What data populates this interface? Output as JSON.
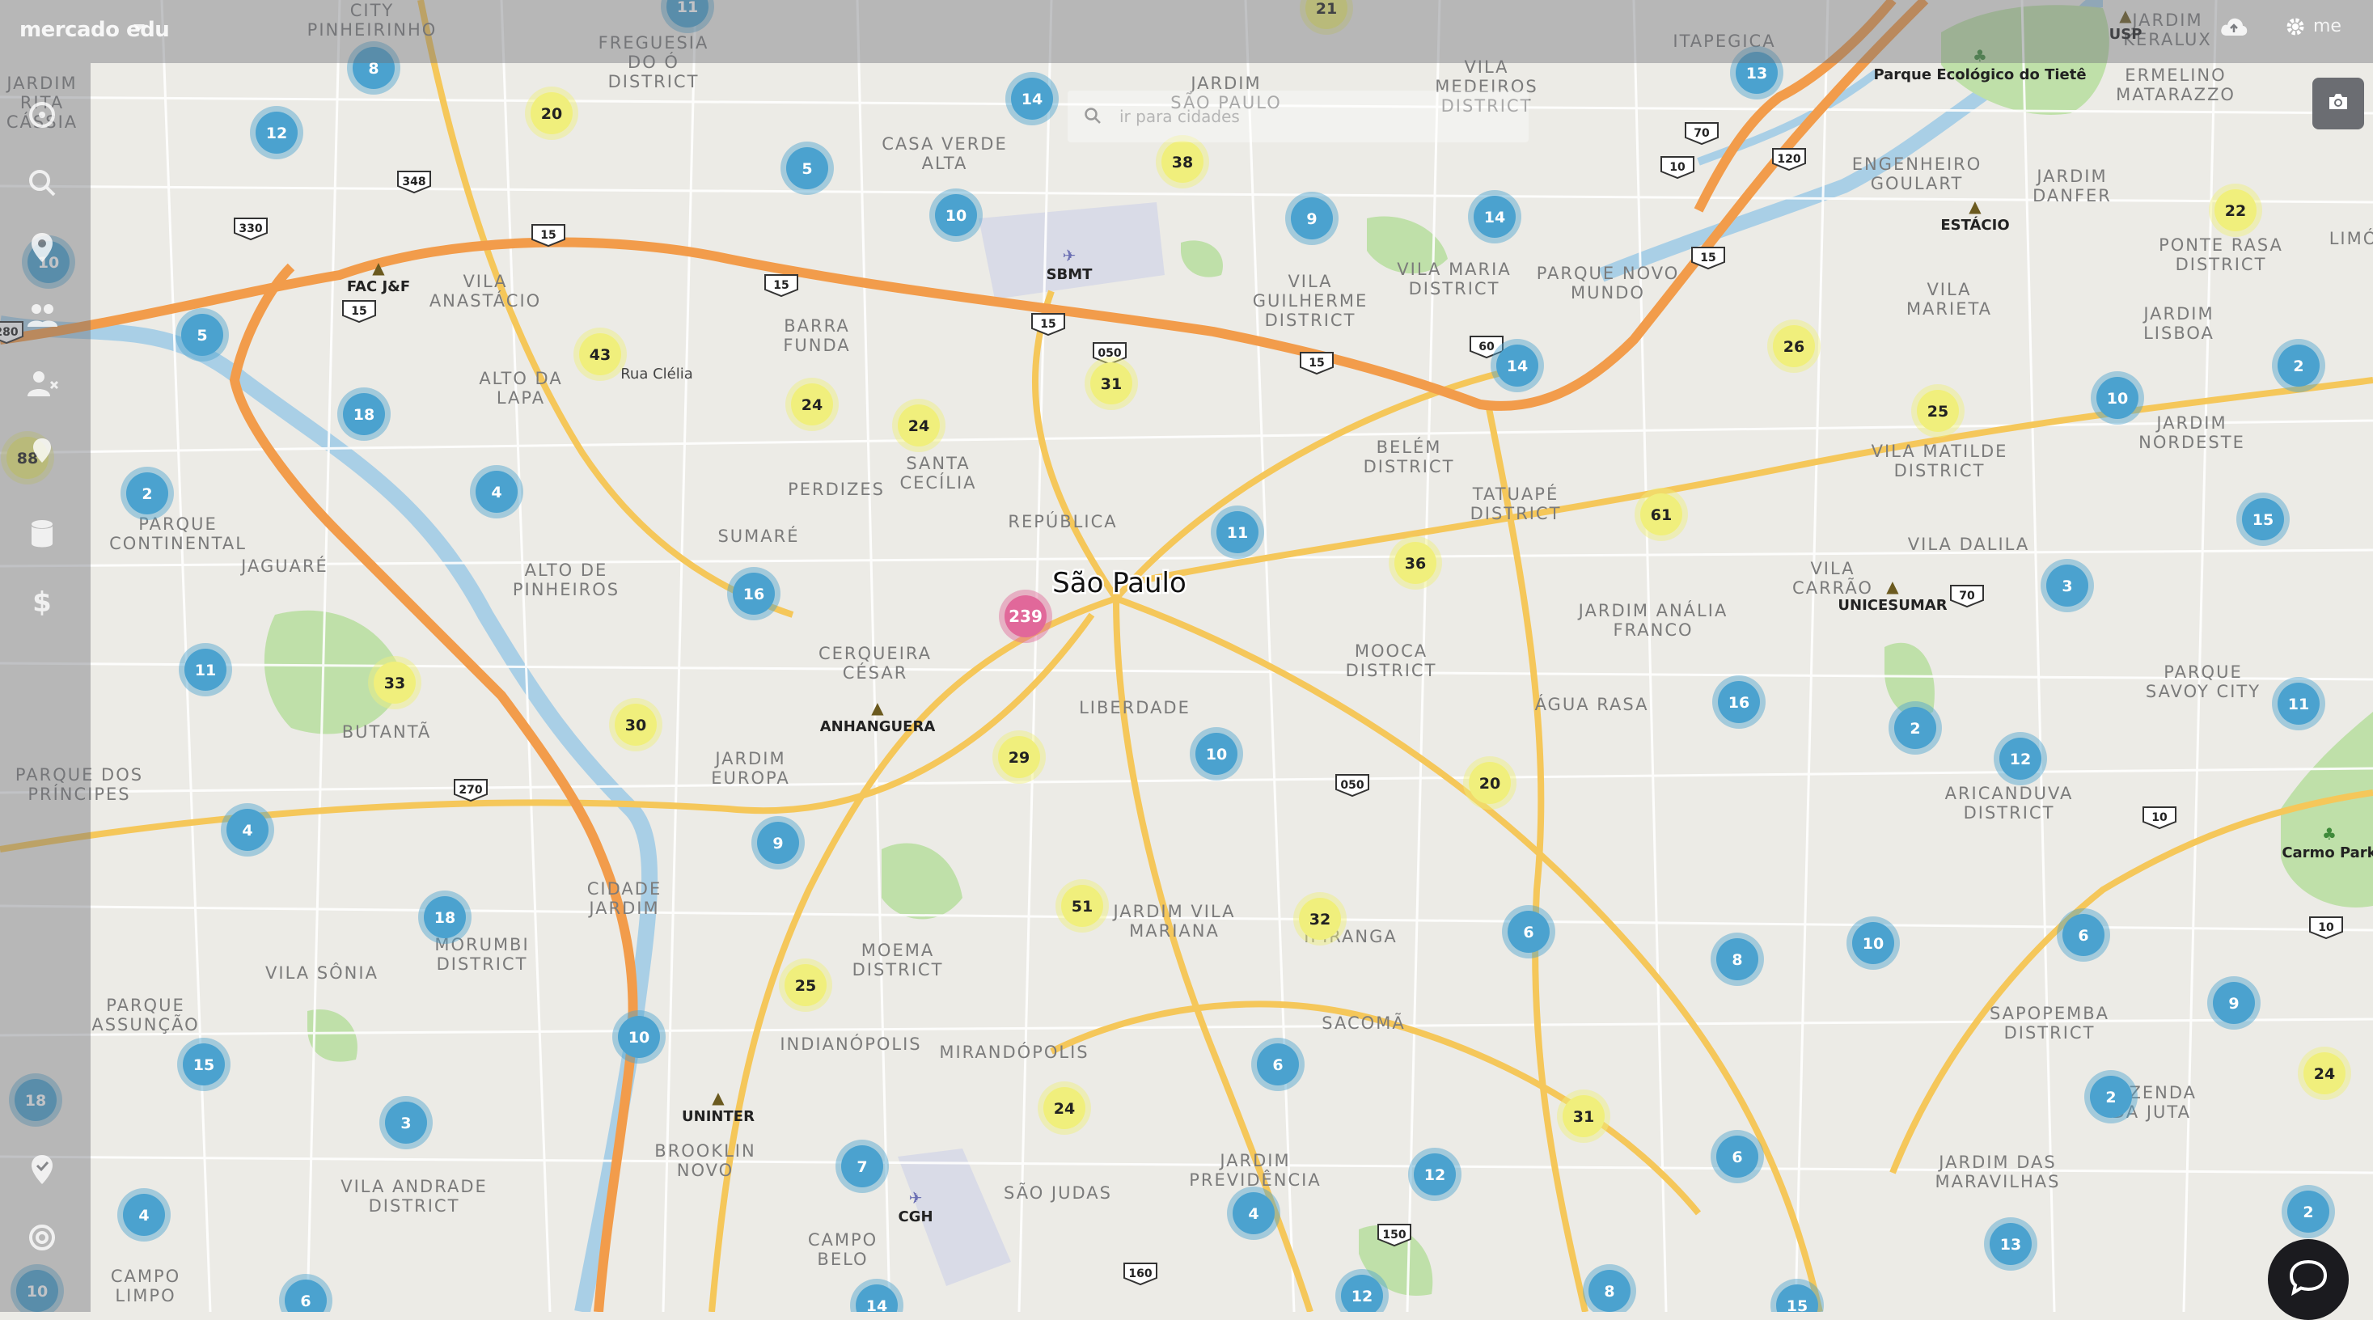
{
  "app": {
    "logo_text": "mercado edu",
    "user_label": "me"
  },
  "search": {
    "placeholder": "ir para cidades"
  },
  "map": {
    "city_label": "São Paulo",
    "colors": {
      "land": "#ecebe6",
      "major_road": "#f5b742",
      "highway": "#f29c4b",
      "street": "#ffffff",
      "park": "#bfe0a9",
      "water": "#a9cfe6",
      "cluster_small": "#4ba2cf",
      "cluster_medium": "#f0ef7c",
      "cluster_large": "#e1689a"
    },
    "districts": [
      {
        "lines": [
          "CITY",
          "PINHEIRINHO"
        ]
      },
      {
        "lines": [
          "FREGUESIA",
          "DO Ó",
          "DISTRICT"
        ]
      },
      {
        "lines": [
          "JARDIM",
          "SÃO PAULO"
        ]
      },
      {
        "lines": [
          "VILA",
          "MEDEIROS",
          "DISTRICT"
        ]
      },
      {
        "lines": [
          "ITAPEGICA"
        ]
      },
      {
        "lines": [
          "JARDIM",
          "KERALUX"
        ]
      },
      {
        "lines": [
          "ERMELINO",
          "MATARAZZO"
        ]
      },
      {
        "lines": [
          "JARDIM",
          "RITA",
          "CÁSSIA"
        ]
      },
      {
        "lines": [
          "CASA VERDE",
          "ALTA"
        ]
      },
      {
        "lines": [
          "ENGENHEIRO",
          "GOULART"
        ]
      },
      {
        "lines": [
          "JARDIM",
          "DANFER"
        ]
      },
      {
        "lines": [
          "VILA MARIA",
          "DISTRICT"
        ]
      },
      {
        "lines": [
          "PARQUE NOVO",
          "MUNDO"
        ]
      },
      {
        "lines": [
          "PONTE RASA",
          "DISTRICT"
        ]
      },
      {
        "lines": [
          "VILA",
          "ANASTÁCIO"
        ]
      },
      {
        "lines": [
          "VILA",
          "GUILHERME",
          "DISTRICT"
        ]
      },
      {
        "lines": [
          "BARRA",
          "FUNDA"
        ]
      },
      {
        "lines": [
          "VILA",
          "MARIETA"
        ]
      },
      {
        "lines": [
          "JARDIM",
          "LISBOA"
        ]
      },
      {
        "lines": [
          "ALTO DA",
          "LAPA"
        ]
      },
      {
        "lines": [
          "BELÉM",
          "DISTRICT"
        ]
      },
      {
        "lines": [
          "JARDIM",
          "NORDESTE"
        ]
      },
      {
        "lines": [
          "VILA MATILDE",
          "DISTRICT"
        ]
      },
      {
        "lines": [
          "PERDIZES"
        ]
      },
      {
        "lines": [
          "SANTA",
          "CECÍLIA"
        ]
      },
      {
        "lines": [
          "TATUAPÉ",
          "DISTRICT"
        ]
      },
      {
        "lines": [
          "PARQUE",
          "CONTINENTAL"
        ]
      },
      {
        "lines": [
          "SUMARÉ"
        ]
      },
      {
        "lines": [
          "REPÚBLICA"
        ]
      },
      {
        "lines": [
          "JAGUARÉ"
        ]
      },
      {
        "lines": [
          "ALTO DE",
          "PINHEIROS"
        ]
      },
      {
        "lines": [
          "VILA DALILA"
        ]
      },
      {
        "lines": [
          "VILA",
          "CARRÃO"
        ]
      },
      {
        "lines": [
          "MOOCA",
          "DISTRICT"
        ]
      },
      {
        "lines": [
          "JARDIM ANÁLIA",
          "FRANCO"
        ]
      },
      {
        "lines": [
          "CERQUEIRA",
          "CÉSAR"
        ]
      },
      {
        "lines": [
          "PARQUE",
          "SAVOY CITY"
        ]
      },
      {
        "lines": [
          "LIBERDADE"
        ]
      },
      {
        "lines": [
          "ÁGUA RASA"
        ]
      },
      {
        "lines": [
          "BUTANTÃ"
        ]
      },
      {
        "lines": [
          "JARDIM",
          "EUROPA"
        ]
      },
      {
        "lines": [
          "PARQUE DOS",
          "PRÍNCIPES"
        ]
      },
      {
        "lines": [
          "ARICANDUVA",
          "DISTRICT"
        ]
      },
      {
        "lines": [
          "CIDADE",
          "JARDIM"
        ]
      },
      {
        "lines": [
          "JARDIM VILA",
          "MARIANA"
        ]
      },
      {
        "lines": [
          "IPIRANGA"
        ]
      },
      {
        "lines": [
          "MORUMBI",
          "DISTRICT"
        ]
      },
      {
        "lines": [
          "MOEMA",
          "DISTRICT"
        ]
      },
      {
        "lines": [
          "VILA SÔNIA"
        ]
      },
      {
        "lines": [
          "PARQUE",
          "ASSUNÇÃO"
        ]
      },
      {
        "lines": [
          "SAPOPEMBA",
          "DISTRICT"
        ]
      },
      {
        "lines": [
          "INDIANÓPOLIS"
        ]
      },
      {
        "lines": [
          "MIRANDÓPOLIS"
        ]
      },
      {
        "lines": [
          "SACOMÃ"
        ]
      },
      {
        "lines": [
          "FAZENDA",
          "DA JUTA"
        ]
      },
      {
        "lines": [
          "BROOKLIN",
          "NOVO"
        ]
      },
      {
        "lines": [
          "JARDIM",
          "PREVIDÊNCIA"
        ]
      },
      {
        "lines": [
          "JARDIM DAS",
          "MARAVILHAS"
        ]
      },
      {
        "lines": [
          "VILA ANDRADE",
          "DISTRICT"
        ]
      },
      {
        "lines": [
          "SÃO JUDAS"
        ]
      },
      {
        "lines": [
          "CAMPO",
          "BELO"
        ]
      },
      {
        "lines": [
          "CAMPO",
          "LIMPO"
        ]
      },
      {
        "lines": [
          "LIMÓ"
        ]
      }
    ],
    "pois": [
      {
        "label": "SBMT",
        "type": "airport"
      },
      {
        "label": "CGH",
        "type": "airport"
      },
      {
        "label": "FAC J&F",
        "type": "university"
      },
      {
        "label": "ANHANGUERA",
        "type": "university"
      },
      {
        "label": "UNINTER",
        "type": "university"
      },
      {
        "label": "ESTÁCIO",
        "type": "university"
      },
      {
        "label": "UNICESUMAR",
        "type": "university"
      },
      {
        "label": "USP",
        "type": "university"
      },
      {
        "label": "Parque Ecológico do Tietê",
        "type": "park"
      },
      {
        "label": "Carmo Park",
        "type": "park"
      }
    ],
    "street_labels": [
      "Rua Clélia"
    ],
    "route_shields": [
      "348",
      "330",
      "15",
      "15",
      "15",
      "15",
      "15",
      "15",
      "280",
      "050",
      "050",
      "270",
      "60",
      "70",
      "10",
      "120",
      "70",
      "10",
      "10",
      "160",
      "150"
    ],
    "clusters": [
      {
        "count": 8
      },
      {
        "count": 11
      },
      {
        "count": 21
      },
      {
        "count": 13
      },
      {
        "count": 12
      },
      {
        "count": 20
      },
      {
        "count": 5
      },
      {
        "count": 14
      },
      {
        "count": 38
      },
      {
        "count": 10
      },
      {
        "count": 10
      },
      {
        "count": 9
      },
      {
        "count": 14
      },
      {
        "count": 22
      },
      {
        "count": 5
      },
      {
        "count": 43
      },
      {
        "count": 24
      },
      {
        "count": 24
      },
      {
        "count": 31
      },
      {
        "count": 14
      },
      {
        "count": 26
      },
      {
        "count": 25
      },
      {
        "count": 2
      },
      {
        "count": 10
      },
      {
        "count": 18
      },
      {
        "count": 88
      },
      {
        "count": 2
      },
      {
        "count": 4
      },
      {
        "count": 11
      },
      {
        "count": 61
      },
      {
        "count": 36
      },
      {
        "count": 15
      },
      {
        "count": 16
      },
      {
        "count": 239
      },
      {
        "count": 3
      },
      {
        "count": 11
      },
      {
        "count": 33
      },
      {
        "count": 16
      },
      {
        "count": 2
      },
      {
        "count": 11
      },
      {
        "count": 30
      },
      {
        "count": 29
      },
      {
        "count": 10
      },
      {
        "count": 12
      },
      {
        "count": 20
      },
      {
        "count": 4
      },
      {
        "count": 9
      },
      {
        "count": 18
      },
      {
        "count": 51
      },
      {
        "count": 32
      },
      {
        "count": 6
      },
      {
        "count": 10
      },
      {
        "count": 6
      },
      {
        "count": 8
      },
      {
        "count": 25
      },
      {
        "count": 10
      },
      {
        "count": 9
      },
      {
        "count": 15
      },
      {
        "count": 6
      },
      {
        "count": 18
      },
      {
        "count": 24
      },
      {
        "count": 3
      },
      {
        "count": 24
      },
      {
        "count": 31
      },
      {
        "count": 2
      },
      {
        "count": 7
      },
      {
        "count": 6
      },
      {
        "count": 12
      },
      {
        "count": 4
      },
      {
        "count": 4
      },
      {
        "count": 2
      },
      {
        "count": 13
      },
      {
        "count": 10
      },
      {
        "count": 6
      },
      {
        "count": 14
      },
      {
        "count": 12
      },
      {
        "count": 8
      },
      {
        "count": 15
      }
    ]
  },
  "sidebar": {
    "icons": [
      "compass-icon",
      "search-icon",
      "location-pin-icon",
      "users-icon",
      "user-remove-icon",
      "map-pin-icon",
      "database-icon",
      "dollar-icon",
      "check-pin-icon",
      "support-icon"
    ]
  }
}
